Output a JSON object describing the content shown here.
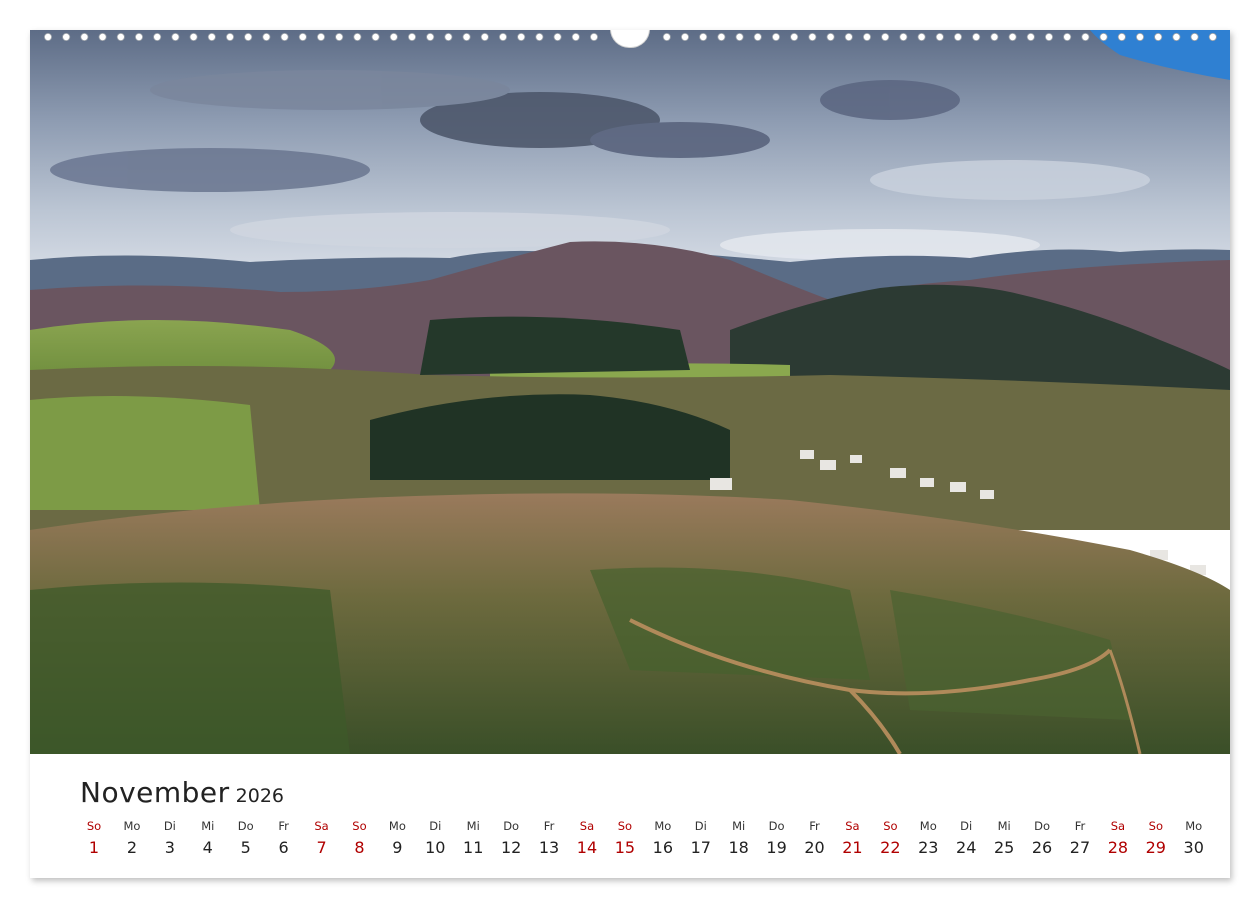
{
  "calendar": {
    "month": "November",
    "year": "2026",
    "weekend_color": "#b00000",
    "days": [
      {
        "weekday": "So",
        "day": "1",
        "weekend": true
      },
      {
        "weekday": "Mo",
        "day": "2",
        "weekend": false
      },
      {
        "weekday": "Di",
        "day": "3",
        "weekend": false
      },
      {
        "weekday": "Mi",
        "day": "4",
        "weekend": false
      },
      {
        "weekday": "Do",
        "day": "5",
        "weekend": false
      },
      {
        "weekday": "Fr",
        "day": "6",
        "weekend": false
      },
      {
        "weekday": "Sa",
        "day": "7",
        "weekend": true
      },
      {
        "weekday": "So",
        "day": "8",
        "weekend": true
      },
      {
        "weekday": "Mo",
        "day": "9",
        "weekend": false
      },
      {
        "weekday": "Di",
        "day": "10",
        "weekend": false
      },
      {
        "weekday": "Mi",
        "day": "11",
        "weekend": false
      },
      {
        "weekday": "Do",
        "day": "12",
        "weekend": false
      },
      {
        "weekday": "Fr",
        "day": "13",
        "weekend": false
      },
      {
        "weekday": "Sa",
        "day": "14",
        "weekend": true
      },
      {
        "weekday": "So",
        "day": "15",
        "weekend": true
      },
      {
        "weekday": "Mo",
        "day": "16",
        "weekend": false
      },
      {
        "weekday": "Di",
        "day": "17",
        "weekend": false
      },
      {
        "weekday": "Mi",
        "day": "18",
        "weekend": false
      },
      {
        "weekday": "Do",
        "day": "19",
        "weekend": false
      },
      {
        "weekday": "Fr",
        "day": "20",
        "weekend": false
      },
      {
        "weekday": "Sa",
        "day": "21",
        "weekend": true
      },
      {
        "weekday": "So",
        "day": "22",
        "weekend": true
      },
      {
        "weekday": "Mo",
        "day": "23",
        "weekend": false
      },
      {
        "weekday": "Di",
        "day": "24",
        "weekend": false
      },
      {
        "weekday": "Mi",
        "day": "25",
        "weekend": false
      },
      {
        "weekday": "Do",
        "day": "26",
        "weekend": false
      },
      {
        "weekday": "Fr",
        "day": "27",
        "weekend": false
      },
      {
        "weekday": "Sa",
        "day": "28",
        "weekend": true
      },
      {
        "weekday": "So",
        "day": "29",
        "weekend": true
      },
      {
        "weekday": "Mo",
        "day": "30",
        "weekend": false
      }
    ]
  },
  "photo": {
    "subject": "landscape-photo",
    "colors": {
      "sky_top": "#5a6a85",
      "sky_mid": "#a9b6c8",
      "sky_low": "#d7dde6",
      "blue_patch": "#2d7fd0",
      "far_hills": "#4e5f78",
      "mid_hills": "#2f3d35",
      "meadow": "#7f9a45",
      "forest": "#1f3020",
      "foreground_brown": "#8a6a4c",
      "foreground_green": "#3f5a2c"
    }
  }
}
